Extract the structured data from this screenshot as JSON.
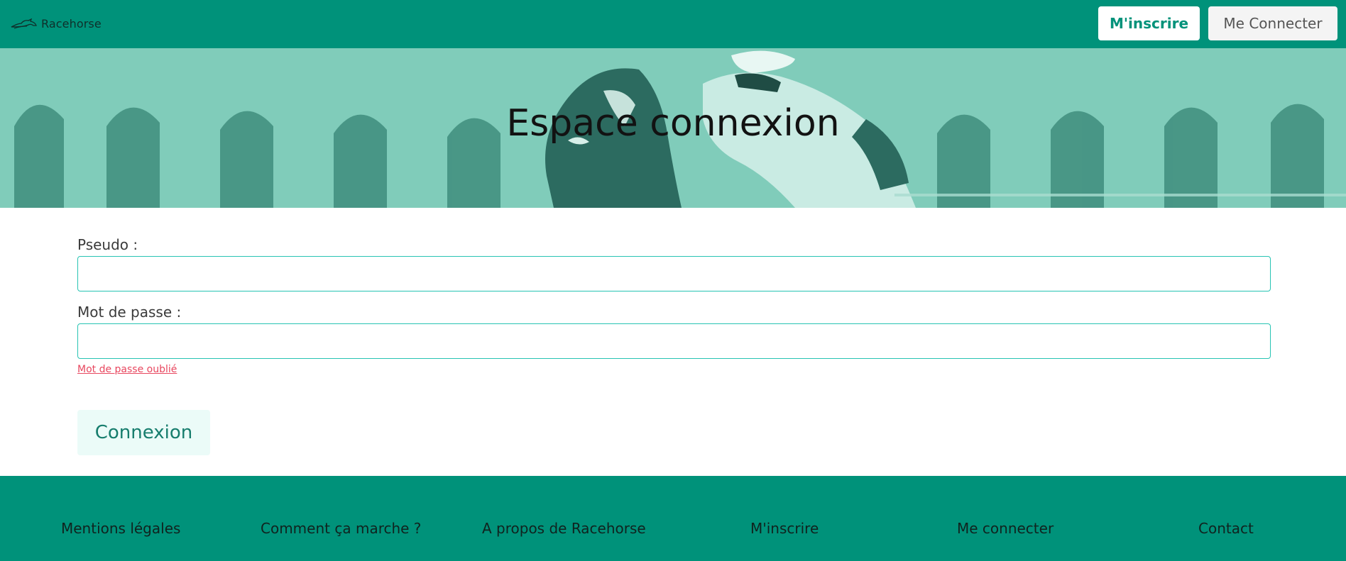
{
  "header": {
    "logo_text": "Racehorse",
    "signup_label": "M'inscrire",
    "login_label": "Me Connecter"
  },
  "hero": {
    "title": "Espace connexion"
  },
  "form": {
    "pseudo_label": "Pseudo :",
    "pseudo_value": "",
    "password_label": "Mot de passe :",
    "password_value": "",
    "forgot_link": "Mot de passe oublié",
    "submit_label": "Connexion"
  },
  "footer": {
    "links": [
      "Mentions légales",
      "Comment ça marche ?",
      "A propos de Racehorse",
      "M'inscrire",
      "Me connecter",
      "Contact"
    ]
  },
  "colors": {
    "primary": "#00927a",
    "hero_tint": "#79c8b6",
    "input_border": "#27c4b3",
    "link": "#e8475f",
    "button_light": "#ebfbf8"
  }
}
